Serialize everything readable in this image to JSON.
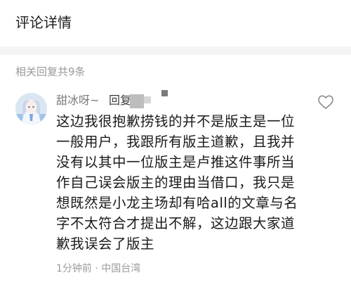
{
  "header": {
    "title": "评论详情"
  },
  "replies": {
    "count_label": "相关回复共9条"
  },
  "comment": {
    "username": "甜冰呀~",
    "reply_label": "回复",
    "text": "这边我很抱歉捞钱的并不是版主是一位一般用户，我跟所有版主道歉，且我并没有以其中一位版主是卢推这件事所当作自己误会版主的理由当借口，我只是想既然是小龙主场却有哈all的文章与名字不太符合才提出不解，这边跟大家道歉我误会了版主",
    "time": "1分钟前",
    "location": "中国台湾",
    "separator": "·"
  },
  "icons": {
    "like": "heart-outline-icon",
    "avatar": "avatar"
  },
  "colors": {
    "background": "#ffffff",
    "divider": "#f4f4f4",
    "muted_text": "#9a9a9a",
    "body_text": "#1a1a1a"
  }
}
